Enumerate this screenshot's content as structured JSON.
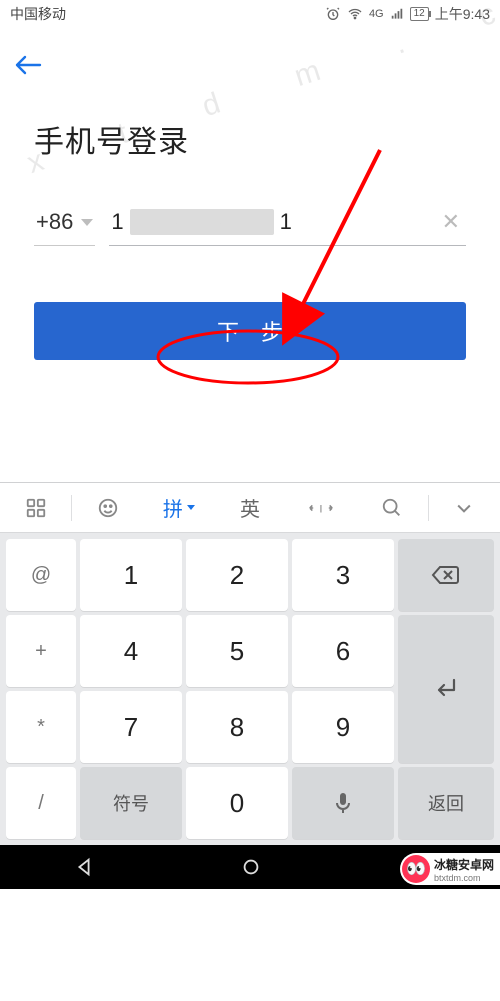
{
  "status": {
    "carrier": "中国移动",
    "net": "4G",
    "battery": "12",
    "time": "上午9:43"
  },
  "page": {
    "title": "手机号登录",
    "country_code": "+86",
    "phone_prefix": "1",
    "phone_suffix": "1",
    "next_label": "下一步"
  },
  "keyboard": {
    "toolbar": {
      "pinyin": "拼",
      "english": "英"
    },
    "side": [
      "@",
      "+",
      "*",
      "/"
    ],
    "digits": [
      "1",
      "2",
      "3",
      "4",
      "5",
      "6",
      "7",
      "8",
      "9",
      "0"
    ],
    "symbols_label": "符号",
    "return_label": "返回"
  },
  "watermark": "b t x t d m . c o m    b t x t d m . c o m    b t x t d m . c o m    b t x t d m . c o m    b t x t d m . c o m    b t x t d m . c o m",
  "brand": {
    "cn": "冰糖安卓网",
    "en": "btxtdm.com"
  }
}
